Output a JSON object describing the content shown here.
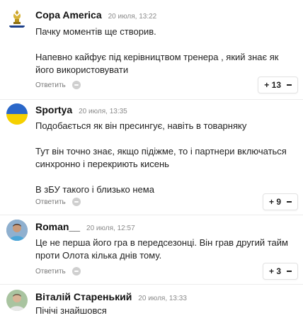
{
  "comments": [
    {
      "author": "Copa America",
      "time": "20 июля, 13:22",
      "text": [
        "Пачку моментів ще створив.",
        "Напевно кайфує під керівництвом тренера , який знає як його використовувати"
      ],
      "reply_label": "Ответить",
      "votes": "+ 13",
      "avatar": "copa-america-logo"
    },
    {
      "author": "Sportya",
      "time": "20 июля, 13:35",
      "text": [
        "Подобається як він пресингує, навіть в товарняку",
        "Тут він точно знає, якщо підіжме, то і партнери включаться синхронно і перекриють кисень",
        "В зБУ такого і близько нема"
      ],
      "reply_label": "Ответить",
      "votes": "+ 9",
      "avatar": "ukraine-flag-avatar"
    },
    {
      "author": "Roman__",
      "time": "20 июля, 12:57",
      "text": [
        "Це не перша його гра в передсезонці. Він грав другий тайм проти Олота кілька днів тому."
      ],
      "reply_label": "Ответить",
      "votes": "+ 3",
      "avatar": "user-photo-avatar"
    },
    {
      "author": "Віталій Старенький",
      "time": "20 июля, 13:33",
      "text": [
        "Пічічі знайшовся"
      ],
      "avatar": "user-photo-avatar"
    }
  ]
}
